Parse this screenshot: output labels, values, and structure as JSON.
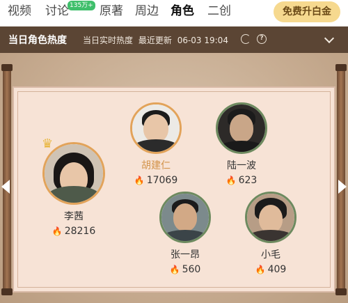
{
  "tabs": [
    {
      "label": "视频"
    },
    {
      "label": "讨论",
      "badge": "135万+"
    },
    {
      "label": "原著"
    },
    {
      "label": "周边"
    },
    {
      "label": "角色",
      "active": true
    },
    {
      "label": "二创"
    }
  ],
  "vip_button": "免费升白金",
  "header": {
    "title": "当日角色热度",
    "realtime_label": "当日实时热度",
    "updated_label": "最近更新",
    "updated_time": "06-03 19:04",
    "refresh_icon": "refresh-icon",
    "help_icon": "help-icon"
  },
  "characters": [
    {
      "name": "李茜",
      "score": "28216",
      "rank": 1,
      "crown": true
    },
    {
      "name": "胡建仁",
      "score": "17069",
      "rank": 2
    },
    {
      "name": "陆一波",
      "score": "623",
      "rank": 3
    },
    {
      "name": "张一昂",
      "score": "560",
      "rank": 4
    },
    {
      "name": "小毛",
      "score": "409",
      "rank": 5
    }
  ],
  "colors": {
    "header_band": "#5b4534",
    "vip_button": "#f6d98f",
    "highlight_name": "#d3934a",
    "flame": "#f0a23b",
    "avatar_border_gold": "#e2a35a",
    "avatar_border_green": "#6d8a5f"
  }
}
